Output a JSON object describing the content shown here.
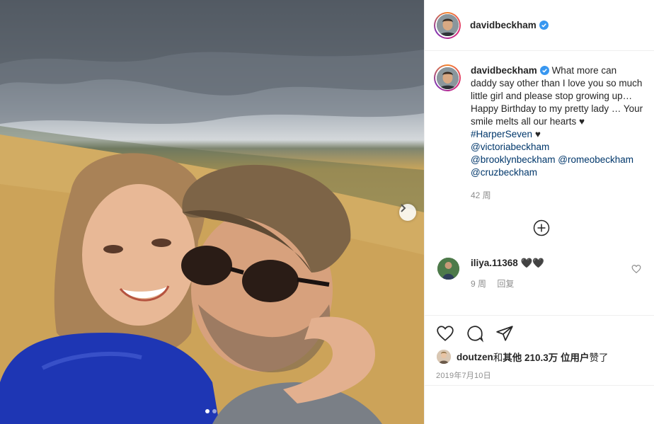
{
  "post": {
    "username": "davidbeckham",
    "caption_parts": {
      "text": "What more can daddy say other than I love you so much little girl and please stop growing up… Happy Birthday to my pretty lady … Your smile melts all our hearts ♥ ",
      "hashtag": "#HarperSeven",
      "after_hashtag": " ♥",
      "mention1": "@victoriabeckham",
      "mention2": "@brooklynbeckham",
      "mention3": "@romeobeckham",
      "mention4": "@cruzbeckham"
    },
    "caption_age": "42 周",
    "carousel": {
      "slides": 2,
      "active": 1
    }
  },
  "comment": {
    "username": "iliya.11368",
    "text": "🖤🖤",
    "age": "9 周",
    "reply_label": "回复"
  },
  "likes": {
    "user": "doutzen",
    "conj": " 和 ",
    "others": "其他 210.3万 位用户",
    "suffix": " 赞了"
  },
  "date": "2019年7月10日",
  "colors": {
    "verified": "#3897f0",
    "link": "#00376b",
    "muted": "#8e8e8e"
  }
}
